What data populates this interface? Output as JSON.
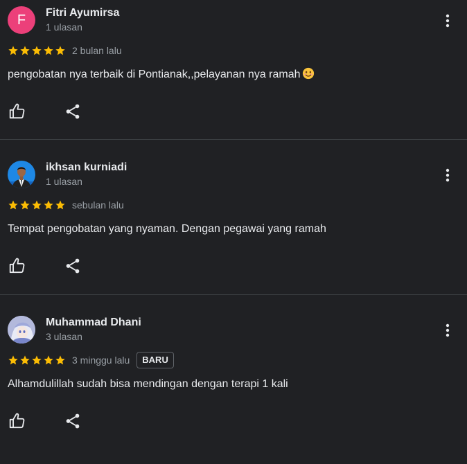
{
  "reviews": [
    {
      "avatar_letter": "F",
      "avatar_color": "#ec407a",
      "name": "Fitri Ayumirsa",
      "review_count": "1 ulasan",
      "rating": 5,
      "time": "2 bulan lalu",
      "text": "pengobatan nya terbaik di Pontianak,,pelayanan nya ramah",
      "emoji": "smiling-face-icon"
    },
    {
      "avatar_icon": "person-in-suit-photo",
      "name": "ikhsan kurniadi",
      "review_count": "1 ulasan",
      "rating": 5,
      "time": "sebulan lalu",
      "text": "Tempat pengobatan yang nyaman. Dengan pegawai yang ramah"
    },
    {
      "avatar_icon": "anime-character-photo",
      "name": "Muhammad Dhani",
      "review_count": "3 ulasan",
      "rating": 5,
      "time": "3 minggu lalu",
      "badge": "BARU",
      "text": "Alhamdulillah sudah bisa mendingan dengan terapi 1 kali"
    }
  ],
  "colors": {
    "background": "#202124",
    "star": "#fbbc04",
    "primary_text": "#e8eaed",
    "secondary_text": "#9aa0a6",
    "divider": "#3c4043"
  },
  "icons": {
    "menu": "more-vert-icon",
    "like": "thumb-up-icon",
    "share": "share-icon",
    "star": "star-icon"
  }
}
